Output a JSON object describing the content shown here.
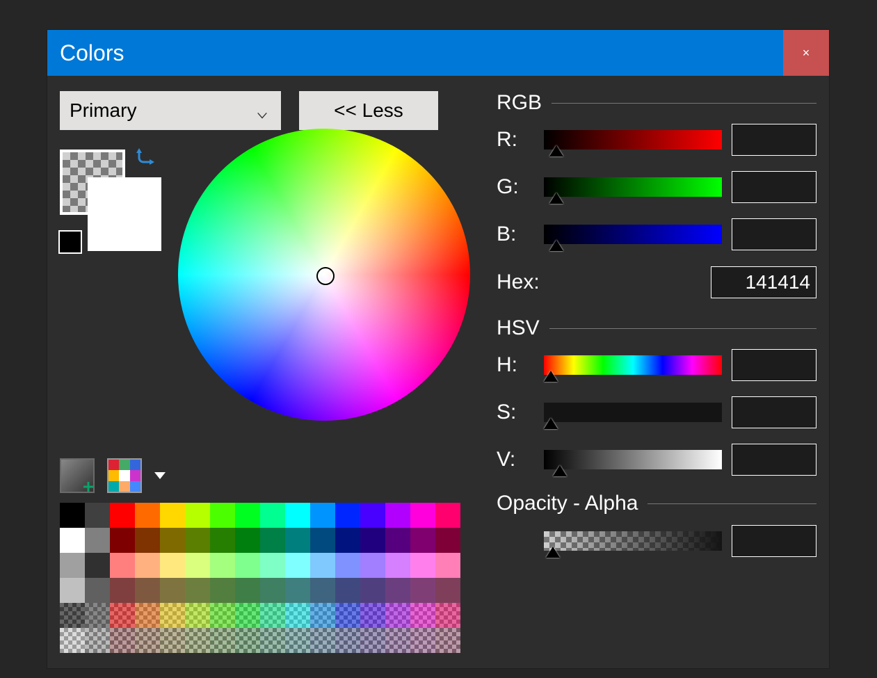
{
  "window": {
    "title": "Colors",
    "close_glyph": "×"
  },
  "combo": {
    "value": "Primary"
  },
  "less_button": "<< Less",
  "rgb": {
    "heading": "RGB",
    "r_label": "R:",
    "g_label": "G:",
    "b_label": "B:",
    "r_value": "20",
    "g_value": "20",
    "b_value": "20"
  },
  "hex": {
    "label": "Hex:",
    "value": "141414"
  },
  "hsv": {
    "heading": "HSV",
    "h_label": "H:",
    "s_label": "S:",
    "v_label": "V:",
    "h_value": "0",
    "s_value": "0",
    "v_value": "7"
  },
  "alpha": {
    "heading": "Opacity - Alpha",
    "value": "0"
  },
  "palette_colors": [
    [
      "#000000",
      "#404040",
      "#ff0000",
      "#ff6a00",
      "#ffd800",
      "#b6ff00",
      "#4cff00",
      "#00ff21",
      "#00ff90",
      "#00ffff",
      "#0094ff",
      "#0026ff",
      "#4800ff",
      "#b200ff",
      "#ff00dc",
      "#ff006e"
    ],
    [
      "#ffffff",
      "#808080",
      "#7f0000",
      "#7f3300",
      "#7f6a00",
      "#5b7f00",
      "#267f00",
      "#007f0e",
      "#007f46",
      "#007f7f",
      "#004a7f",
      "#00137f",
      "#21007f",
      "#57007f",
      "#7f006e",
      "#7f0037"
    ],
    [
      "#a0a0a0",
      "#303030",
      "#ff7f7f",
      "#ffb27f",
      "#ffe97f",
      "#daff7f",
      "#a5ff7f",
      "#7fff8e",
      "#7fffc5",
      "#7fffff",
      "#7fc9ff",
      "#7f92ff",
      "#a17fff",
      "#d67fff",
      "#ff7fed",
      "#ff7fb6"
    ],
    [
      "#c0c0c0",
      "#606060",
      "#7f3f3f",
      "#7f593f",
      "#7f743f",
      "#6d7f3f",
      "#527f3f",
      "#3f7f47",
      "#3f7f62",
      "#3f7f7f",
      "#3f647f",
      "#3f497f",
      "#503f7f",
      "#6b3f7f",
      "#7f3f76",
      "#7f3f5b"
    ]
  ],
  "alpha_palette_colors": [
    [
      "#000000",
      "#404040",
      "#ff0000",
      "#ff6a00",
      "#ffd800",
      "#b6ff00",
      "#4cff00",
      "#00ff21",
      "#00ff90",
      "#00ffff",
      "#0094ff",
      "#0026ff",
      "#4800ff",
      "#b200ff",
      "#ff00dc",
      "#ff006e"
    ],
    [
      "#ffffff",
      "#808080",
      "#7f0000",
      "#7f3300",
      "#7f6a00",
      "#5b7f00",
      "#267f00",
      "#007f0e",
      "#007f46",
      "#007f7f",
      "#004a7f",
      "#00137f",
      "#21007f",
      "#57007f",
      "#7f006e",
      "#7f0037"
    ]
  ]
}
